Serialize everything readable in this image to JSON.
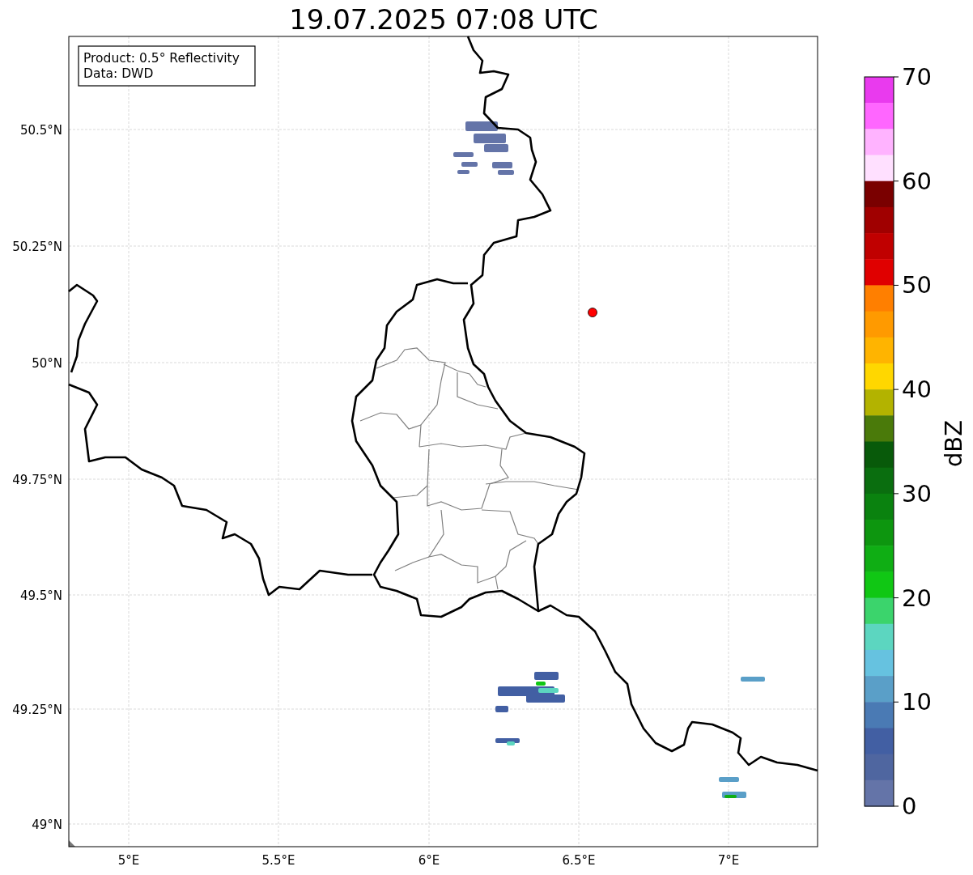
{
  "title": "19.07.2025 07:08 UTC",
  "legend": [
    "Product: 0.5° Reflectivity",
    "Data: DWD"
  ],
  "xticks": [
    "5°E",
    "5.5°E",
    "6°E",
    "6.5°E",
    "7°E"
  ],
  "yticks": [
    "50.5°N",
    "50.25°N",
    "50°N",
    "49.75°N",
    "49.5°N",
    "49.25°N",
    "49°N"
  ],
  "colorbar": {
    "label": "dBZ",
    "ticks": [
      "70",
      "60",
      "50",
      "40",
      "30",
      "20",
      "10",
      "0"
    ],
    "segments": [
      {
        "color": "#e93aee"
      },
      {
        "color": "#ff66ff"
      },
      {
        "color": "#ffb3ff"
      },
      {
        "color": "#ffe0ff"
      },
      {
        "color": "#7a0000"
      },
      {
        "color": "#a00000"
      },
      {
        "color": "#c00000"
      },
      {
        "color": "#e00000"
      },
      {
        "color": "#ff7f00"
      },
      {
        "color": "#ff9a00"
      },
      {
        "color": "#ffb400"
      },
      {
        "color": "#ffd700"
      },
      {
        "color": "#b3b300"
      },
      {
        "color": "#4a7a0a"
      },
      {
        "color": "#085a0a"
      },
      {
        "color": "#0a6e0f"
      },
      {
        "color": "#0a820f"
      },
      {
        "color": "#0d960f"
      },
      {
        "color": "#0fae14"
      },
      {
        "color": "#10c714"
      },
      {
        "color": "#3bd46c"
      },
      {
        "color": "#5cd6c0"
      },
      {
        "color": "#66c2e0"
      },
      {
        "color": "#5a9fc8"
      },
      {
        "color": "#4a7ab4"
      },
      {
        "color": "#425fa3"
      },
      {
        "color": "#4f66a0"
      },
      {
        "color": "#6474a8"
      }
    ]
  }
}
